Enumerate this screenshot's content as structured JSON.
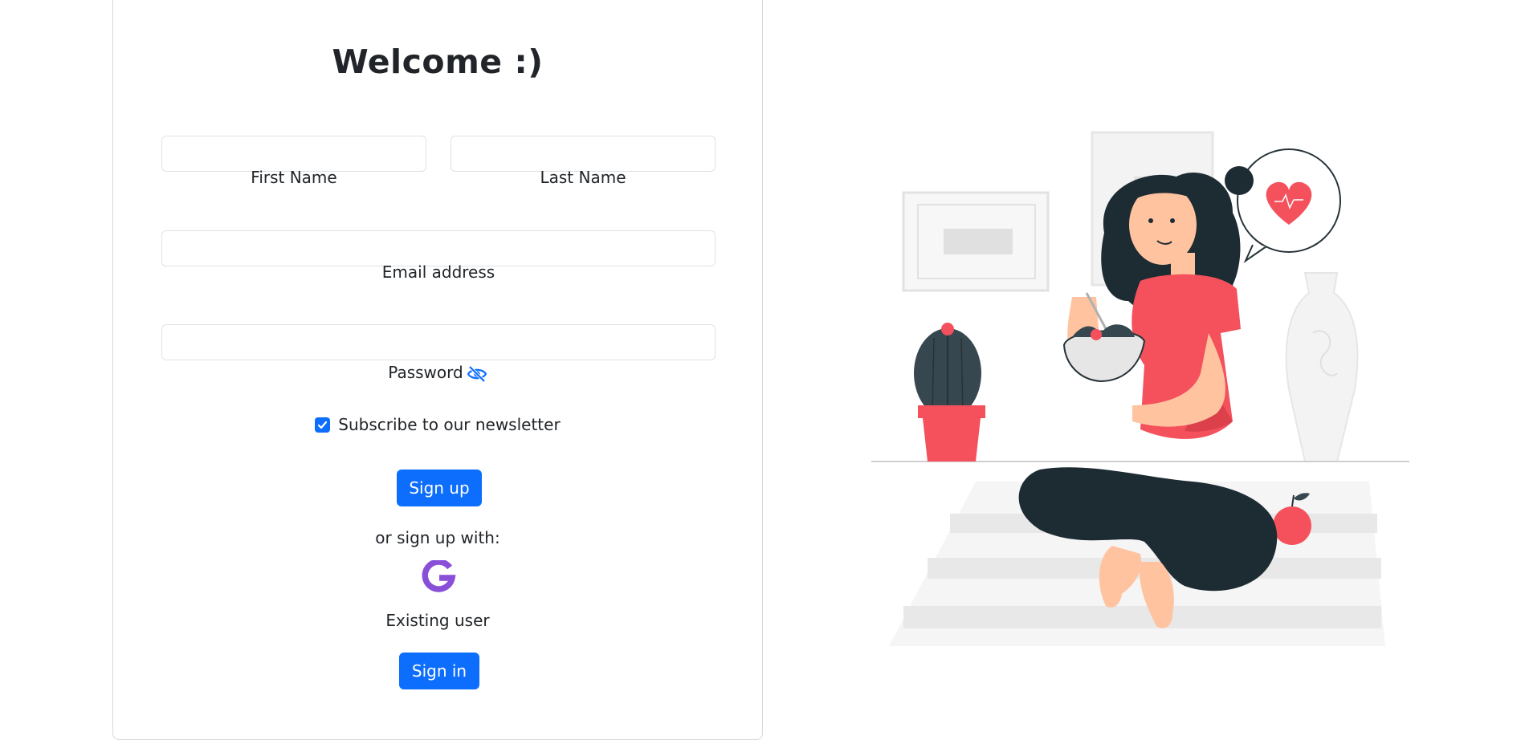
{
  "form": {
    "title": "Welcome :)",
    "first_name": {
      "label": "First Name",
      "value": "",
      "placeholder": ""
    },
    "last_name": {
      "label": "Last Name",
      "value": "",
      "placeholder": ""
    },
    "email": {
      "label": "Email address",
      "value": "",
      "placeholder": ""
    },
    "password": {
      "label": "Password",
      "value": "",
      "placeholder": ""
    },
    "newsletter": {
      "label": "Subscribe to our newsletter",
      "checked": true
    },
    "signup_button": "Sign up",
    "alt_signup_text": "or sign up with:",
    "existing_user_text": "Existing user",
    "signin_button": "Sign in"
  },
  "icons": {
    "password_toggle": "eye-slash-icon",
    "google": "google-icon"
  },
  "colors": {
    "primary": "#0d6efd",
    "google_purple": "#8a4fd8",
    "shirt": "#f4515c",
    "hair": "#1d2b33"
  }
}
